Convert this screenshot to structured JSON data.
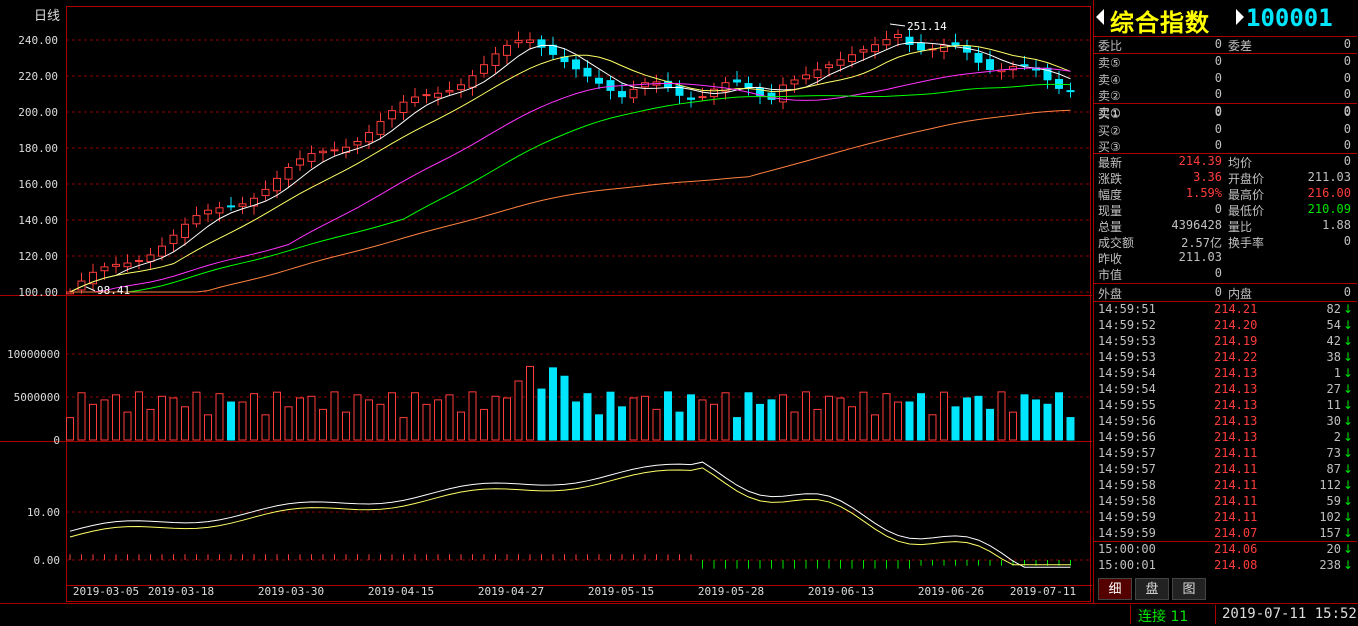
{
  "chart": {
    "period_label": "日线",
    "high_label": "251.14",
    "low_label": "98.41",
    "price_ticks": [
      "240.00",
      "220.00",
      "200.00",
      "180.00",
      "160.00",
      "140.00",
      "120.00",
      "100.00"
    ],
    "volume_ticks": [
      "10000000",
      "5000000",
      "0"
    ],
    "macd_ticks": [
      "10.00",
      "0.00"
    ],
    "date_labels": [
      "2019-03-05",
      "2019-03-18",
      "2019-03-30",
      "2019-04-15",
      "2019-04-27",
      "2019-05-15",
      "2019-05-28",
      "2019-06-13",
      "2019-06-26",
      "2019-07-11"
    ],
    "colors": {
      "up": "#ff3c3c",
      "down": "#00e6ff",
      "ma5": "#ffffff",
      "ma10": "#ffff66",
      "ma20": "#ff33ff",
      "ma30": "#00ff00",
      "ma60": "#ff8040",
      "grid": "#8b0000"
    }
  },
  "quote": {
    "name": "综合指数",
    "code": "100001",
    "wei_bi_label": "委比",
    "wei_bi": "0",
    "wei_cha_label": "委差",
    "wei_cha": "0",
    "sell": [
      {
        "label": "卖⑤",
        "price": "0",
        "vol": "0"
      },
      {
        "label": "卖④",
        "price": "0",
        "vol": "0"
      },
      {
        "label": "卖②",
        "price": "0",
        "vol": "0"
      },
      {
        "label": "卖①",
        "price": "0",
        "vol": "0"
      }
    ],
    "buy": [
      {
        "label": "买①",
        "price": "0",
        "vol": "0"
      },
      {
        "label": "买②",
        "price": "0",
        "vol": "0"
      },
      {
        "label": "买③",
        "price": "0",
        "vol": "0"
      }
    ],
    "stats": [
      {
        "k1": "最新",
        "v1": "214.39",
        "c1": "red",
        "k2": "均价",
        "v2": "0",
        "c2": ""
      },
      {
        "k1": "涨跌",
        "v1": "3.36",
        "c1": "red",
        "k2": "开盘价",
        "v2": "211.03",
        "c2": ""
      },
      {
        "k1": "幅度",
        "v1": "1.59%",
        "c1": "red",
        "k2": "最高价",
        "v2": "216.00",
        "c2": "red"
      },
      {
        "k1": "现量",
        "v1": "0",
        "c1": "",
        "k2": "最低价",
        "v2": "210.09",
        "c2": "green"
      },
      {
        "k1": "总量",
        "v1": "4396428",
        "c1": "",
        "k2": "量比",
        "v2": "1.88",
        "c2": ""
      },
      {
        "k1": "成交额",
        "v1": "2.57亿",
        "c1": "",
        "k2": "换手率",
        "v2": "0",
        "c2": ""
      },
      {
        "k1": "昨收",
        "v1": "211.03",
        "c1": "",
        "k2": "",
        "v2": "",
        "c2": ""
      },
      {
        "k1": "市值",
        "v1": "0",
        "c1": "",
        "k2": "",
        "v2": "",
        "c2": ""
      }
    ],
    "outer_label": "外盘",
    "outer": "0",
    "inner_label": "内盘",
    "inner": "0"
  },
  "ticks": [
    {
      "time": "14:59:51",
      "price": "214.21",
      "vol": "82"
    },
    {
      "time": "14:59:52",
      "price": "214.20",
      "vol": "54"
    },
    {
      "time": "14:59:53",
      "price": "214.19",
      "vol": "42"
    },
    {
      "time": "14:59:53",
      "price": "214.22",
      "vol": "38"
    },
    {
      "time": "14:59:54",
      "price": "214.13",
      "vol": "1"
    },
    {
      "time": "14:59:54",
      "price": "214.13",
      "vol": "27"
    },
    {
      "time": "14:59:55",
      "price": "214.13",
      "vol": "11"
    },
    {
      "time": "14:59:56",
      "price": "214.13",
      "vol": "30"
    },
    {
      "time": "14:59:56",
      "price": "214.13",
      "vol": "2"
    },
    {
      "time": "14:59:57",
      "price": "214.11",
      "vol": "73"
    },
    {
      "time": "14:59:57",
      "price": "214.11",
      "vol": "87"
    },
    {
      "time": "14:59:58",
      "price": "214.11",
      "vol": "112"
    },
    {
      "time": "14:59:58",
      "price": "214.11",
      "vol": "59"
    },
    {
      "time": "14:59:59",
      "price": "214.11",
      "vol": "102"
    },
    {
      "time": "14:59:59",
      "price": "214.07",
      "vol": "157"
    },
    {
      "time": "15:00:00",
      "price": "214.06",
      "vol": "20"
    },
    {
      "time": "15:00:01",
      "price": "214.08",
      "vol": "238"
    }
  ],
  "tick_arrow": "↓",
  "tabs": [
    "细",
    "盘",
    "图"
  ],
  "status": {
    "connection": "连接 11",
    "datetime": "2019-07-11 15:52"
  }
}
